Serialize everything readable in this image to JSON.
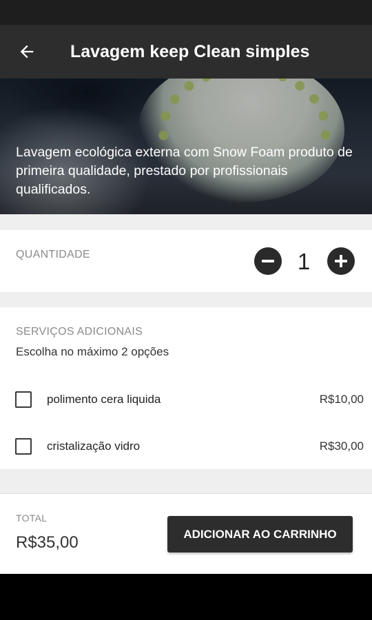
{
  "header": {
    "title": "Lavagem keep Clean simples",
    "back_icon": "arrow-left-icon"
  },
  "hero": {
    "description": "Lavagem ecológica externa com Snow Foam produto de primeira qualidade, prestado por profissionais qualificados."
  },
  "quantity": {
    "label": "QUANTIDADE",
    "value": "1",
    "decrement_icon": "minus-circle-icon",
    "increment_icon": "plus-circle-icon"
  },
  "addons": {
    "title": "SERVIÇOS ADICIONAIS",
    "subtitle": "Escolha no máximo 2 opções",
    "items": [
      {
        "name": "polimento cera liquida",
        "price": "R$10,00",
        "checked": false
      },
      {
        "name": "cristalização vidro",
        "price": "R$30,00",
        "checked": false
      }
    ]
  },
  "footer": {
    "total_label": "TOTAL",
    "total_value": "R$35,00",
    "cart_button": "ADICIONAR AO CARRINHO"
  },
  "colors": {
    "app_bar": "#2d2d2d",
    "button": "#2d2d2d",
    "background": "#efefef"
  }
}
